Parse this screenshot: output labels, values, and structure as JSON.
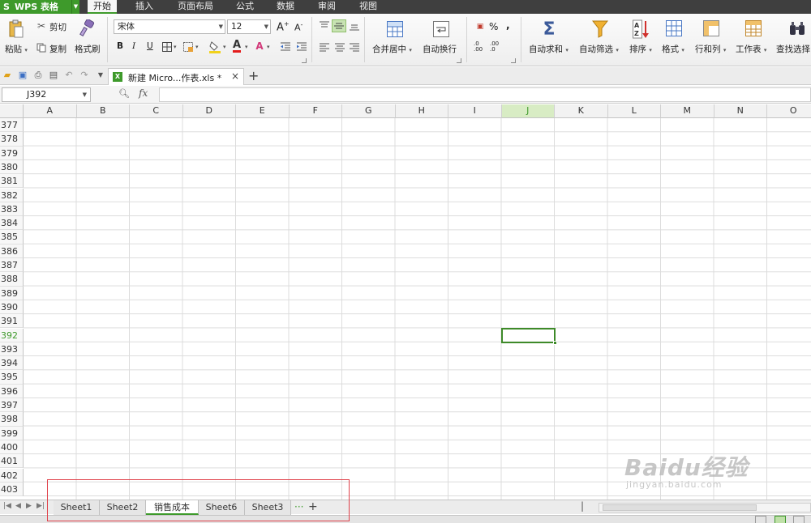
{
  "app": {
    "logo": "S",
    "title": "WPS 表格"
  },
  "menu": {
    "tabs": [
      "开始",
      "插入",
      "页面布局",
      "公式",
      "数据",
      "审阅",
      "视图"
    ],
    "active_index": 0
  },
  "ribbon": {
    "paste_label": "粘贴",
    "cut_label": "剪切",
    "copy_label": "复制",
    "format_painter_label": "格式刷",
    "font_name": "宋体",
    "font_size": "12",
    "grow_font": "A",
    "shrink_font": "A",
    "bold": "B",
    "italic": "I",
    "underline": "U",
    "merge_center_label": "合并居中",
    "wrap_text_label": "自动换行",
    "percent": "%",
    "comma": ",",
    "increase_decimal": ".0 .00",
    "decrease_decimal": ".00 .0",
    "autosum_label": "自动求和",
    "autofilter_label": "自动筛选",
    "sort_label": "排序",
    "format_label": "格式",
    "rows_cols_label": "行和列",
    "worksheet_label": "工作表",
    "find_select_label": "查找选择"
  },
  "quickbar": {
    "doc_tab_name": "新建 Micro...作表.xls *",
    "doc_icon": "X",
    "close_symbol": "×",
    "new_tab_symbol": "+"
  },
  "formula_bar": {
    "name_box": "J392",
    "fx_label": "fx",
    "formula": ""
  },
  "grid": {
    "columns": [
      "A",
      "B",
      "C",
      "D",
      "E",
      "F",
      "G",
      "H",
      "I",
      "J",
      "K",
      "L",
      "M",
      "N",
      "O"
    ],
    "rows": [
      "377",
      "378",
      "379",
      "380",
      "381",
      "382",
      "383",
      "384",
      "385",
      "386",
      "387",
      "388",
      "389",
      "390",
      "391",
      "392",
      "393",
      "394",
      "395",
      "396",
      "397",
      "398",
      "399",
      "400",
      "401",
      "402",
      "403"
    ],
    "selected_column": "J",
    "selected_row": "392"
  },
  "sheets": {
    "tabs": [
      "Sheet1",
      "Sheet2",
      "销售成本",
      "Sheet6",
      "Sheet3"
    ],
    "active": "销售成本",
    "more_symbol": "···",
    "add_symbol": "+"
  },
  "watermark": {
    "brand": "Baidu经验",
    "url": "jingyan.baidu.com"
  },
  "colors": {
    "accent_green": "#3e9a2b",
    "menu_bg": "#3f3f3f",
    "annotation_red": "#e0414a"
  }
}
